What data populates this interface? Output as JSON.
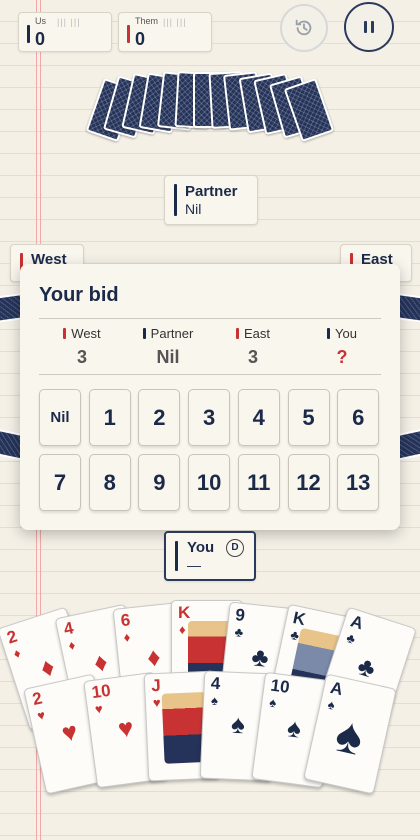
{
  "scores": {
    "us": {
      "label": "Us",
      "value": "0"
    },
    "them": {
      "label": "Them",
      "value": "0"
    }
  },
  "players": {
    "partner": {
      "name": "Partner",
      "bid": "Nil"
    },
    "west": {
      "name": "West"
    },
    "east": {
      "name": "East"
    },
    "you": {
      "name": "You",
      "dealer_badge": "D",
      "bid": "—"
    }
  },
  "bid_panel": {
    "title": "Your bid",
    "summary": [
      {
        "name": "West",
        "bid": "3",
        "color": "#c83232"
      },
      {
        "name": "Partner",
        "bid": "Nil",
        "color": "#1c2a4a"
      },
      {
        "name": "East",
        "bid": "3",
        "color": "#c83232"
      },
      {
        "name": "You",
        "bid": "?",
        "color": "#1c2a4a"
      }
    ],
    "options": [
      "Nil",
      "1",
      "2",
      "3",
      "4",
      "5",
      "6",
      "7",
      "8",
      "9",
      "10",
      "11",
      "12",
      "13"
    ]
  },
  "hand": {
    "row1": [
      {
        "rank": "2",
        "suit": "♦",
        "color": "red"
      },
      {
        "rank": "4",
        "suit": "♦",
        "color": "red"
      },
      {
        "rank": "6",
        "suit": "♦",
        "color": "red"
      },
      {
        "rank": "K",
        "suit": "♦",
        "color": "red"
      },
      {
        "rank": "9",
        "suit": "♣",
        "color": "black"
      },
      {
        "rank": "K",
        "suit": "♣",
        "color": "black"
      },
      {
        "rank": "A",
        "suit": "♣",
        "color": "black"
      }
    ],
    "row2": [
      {
        "rank": "2",
        "suit": "♥",
        "color": "red"
      },
      {
        "rank": "10",
        "suit": "♥",
        "color": "red"
      },
      {
        "rank": "J",
        "suit": "♥",
        "color": "red"
      },
      {
        "rank": "4",
        "suit": "♠",
        "color": "black"
      },
      {
        "rank": "10",
        "suit": "♠",
        "color": "black"
      },
      {
        "rank": "A",
        "suit": "♠",
        "color": "black"
      }
    ]
  },
  "colors": {
    "accent_red": "#c83232",
    "navy": "#1c2a4a",
    "card_back": "#25335a"
  },
  "icons": {
    "history": "history-icon",
    "pause": "pause-icon"
  }
}
